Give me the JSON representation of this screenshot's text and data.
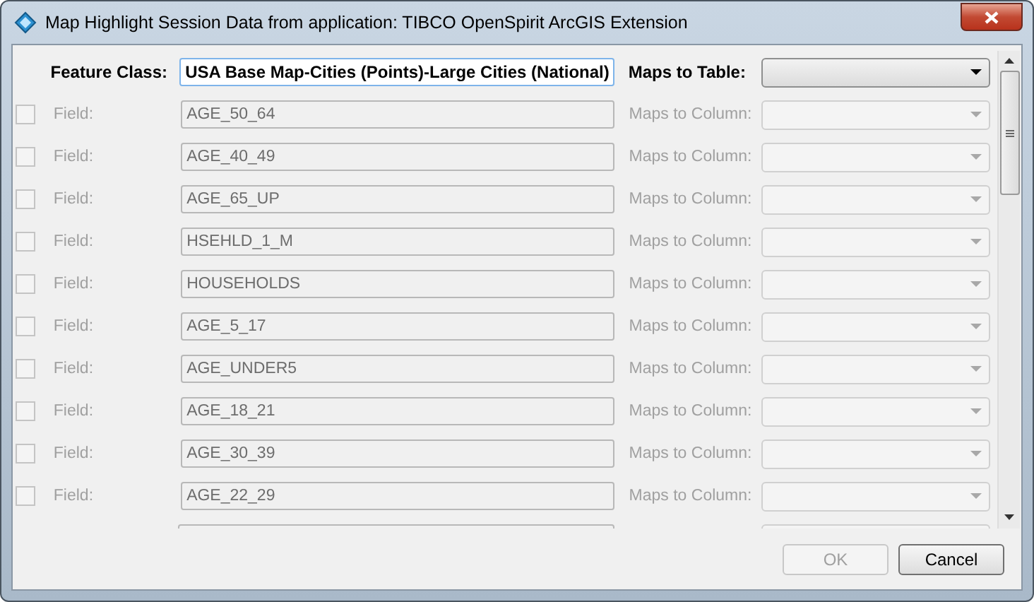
{
  "window": {
    "title": "Map Highlight Session Data from application: TIBCO OpenSpirit ArcGIS Extension"
  },
  "header": {
    "feature_class_label": "Feature Class:",
    "feature_class_value": "USA Base Map-Cities (Points)-Large Cities (National)",
    "table_label": "Maps to Table:"
  },
  "rows": [
    {
      "checked": false,
      "disabled": true,
      "label": "Field:",
      "value": "AGE_50_64",
      "column_label": "Maps to Column:"
    },
    {
      "checked": false,
      "disabled": true,
      "label": "Field:",
      "value": "AGE_40_49",
      "column_label": "Maps to Column:"
    },
    {
      "checked": false,
      "disabled": true,
      "label": "Field:",
      "value": "AGE_65_UP",
      "column_label": "Maps to Column:"
    },
    {
      "checked": false,
      "disabled": true,
      "label": "Field:",
      "value": "HSEHLD_1_M",
      "column_label": "Maps to Column:"
    },
    {
      "checked": false,
      "disabled": true,
      "label": "Field:",
      "value": "HOUSEHOLDS",
      "column_label": "Maps to Column:"
    },
    {
      "checked": false,
      "disabled": true,
      "label": "Field:",
      "value": "AGE_5_17",
      "column_label": "Maps to Column:"
    },
    {
      "checked": false,
      "disabled": true,
      "label": "Field:",
      "value": "AGE_UNDER5",
      "column_label": "Maps to Column:"
    },
    {
      "checked": false,
      "disabled": true,
      "label": "Field:",
      "value": "AGE_18_21",
      "column_label": "Maps to Column:"
    },
    {
      "checked": false,
      "disabled": true,
      "label": "Field:",
      "value": "AGE_30_39",
      "column_label": "Maps to Column:"
    },
    {
      "checked": false,
      "disabled": true,
      "label": "Field:",
      "value": "AGE_22_29",
      "column_label": "Maps to Column:"
    }
  ],
  "buttons": [
    {
      "label": "OK",
      "disabled": true
    },
    {
      "label": "Cancel",
      "disabled": false
    }
  ]
}
